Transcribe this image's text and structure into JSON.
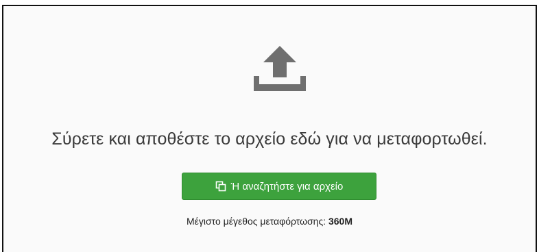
{
  "dropzone": {
    "icon": "upload-icon",
    "prompt": "Σύρετε και αποθέστε το αρχείο εδώ για να μεταφορτωθεί.",
    "browse_button": {
      "icon": "copy-icon",
      "label": "Ή αναζητήστε για αρχείο"
    },
    "max_size": {
      "label": "Μέγιστο μέγεθος μεταφόρτωσης:",
      "value": "360M"
    }
  },
  "colors": {
    "button_bg": "#3da23d",
    "icon": "#6f6f6f",
    "text": "#3a3a3a"
  }
}
